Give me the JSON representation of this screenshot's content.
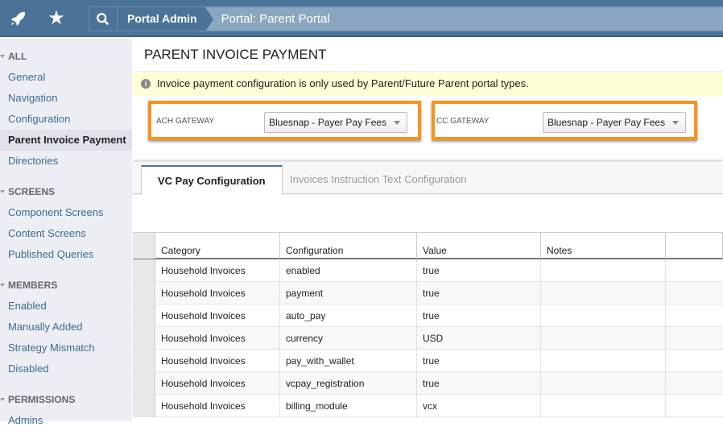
{
  "header": {
    "breadcrumb_root": "Portal Admin",
    "breadcrumb_current": "Portal: Parent Portal"
  },
  "sidebar": {
    "sections": [
      {
        "title": "ALL",
        "items": [
          "General",
          "Navigation",
          "Configuration",
          "Parent Invoice Payment",
          "Directories"
        ]
      },
      {
        "title": "SCREENS",
        "items": [
          "Component Screens",
          "Content Screens",
          "Published Queries"
        ]
      },
      {
        "title": "MEMBERS",
        "items": [
          "Enabled",
          "Manually Added",
          "Strategy Mismatch",
          "Disabled"
        ]
      },
      {
        "title": "PERMISSIONS",
        "items": [
          "Admins"
        ]
      }
    ],
    "active": "Parent Invoice Payment"
  },
  "page": {
    "title": "PARENT INVOICE PAYMENT",
    "notice": "Invoice payment configuration is only used by Parent/Future Parent portal types.",
    "ach_label": "ACH GATEWAY",
    "ach_value": "Bluesnap - Payer Pay Fees",
    "cc_label": "CC GATEWAY",
    "cc_value": "Bluesnap - Payer Pay Fees",
    "highlight_color": "#f7941d"
  },
  "tabs": [
    "VC Pay Configuration",
    "Invoices Instruction Text Configuration"
  ],
  "table": {
    "columns": [
      "Category",
      "Configuration",
      "Value",
      "Notes"
    ],
    "rows": [
      [
        "Household Invoices",
        "enabled",
        "true",
        ""
      ],
      [
        "Household Invoices",
        "payment",
        "true",
        ""
      ],
      [
        "Household Invoices",
        "auto_pay",
        "true",
        ""
      ],
      [
        "Household Invoices",
        "currency",
        "USD",
        ""
      ],
      [
        "Household Invoices",
        "pay_with_wallet",
        "true",
        ""
      ],
      [
        "Household Invoices",
        "vcpay_registration",
        "true",
        ""
      ],
      [
        "Household Invoices",
        "billing_module",
        "vcx",
        ""
      ]
    ]
  }
}
